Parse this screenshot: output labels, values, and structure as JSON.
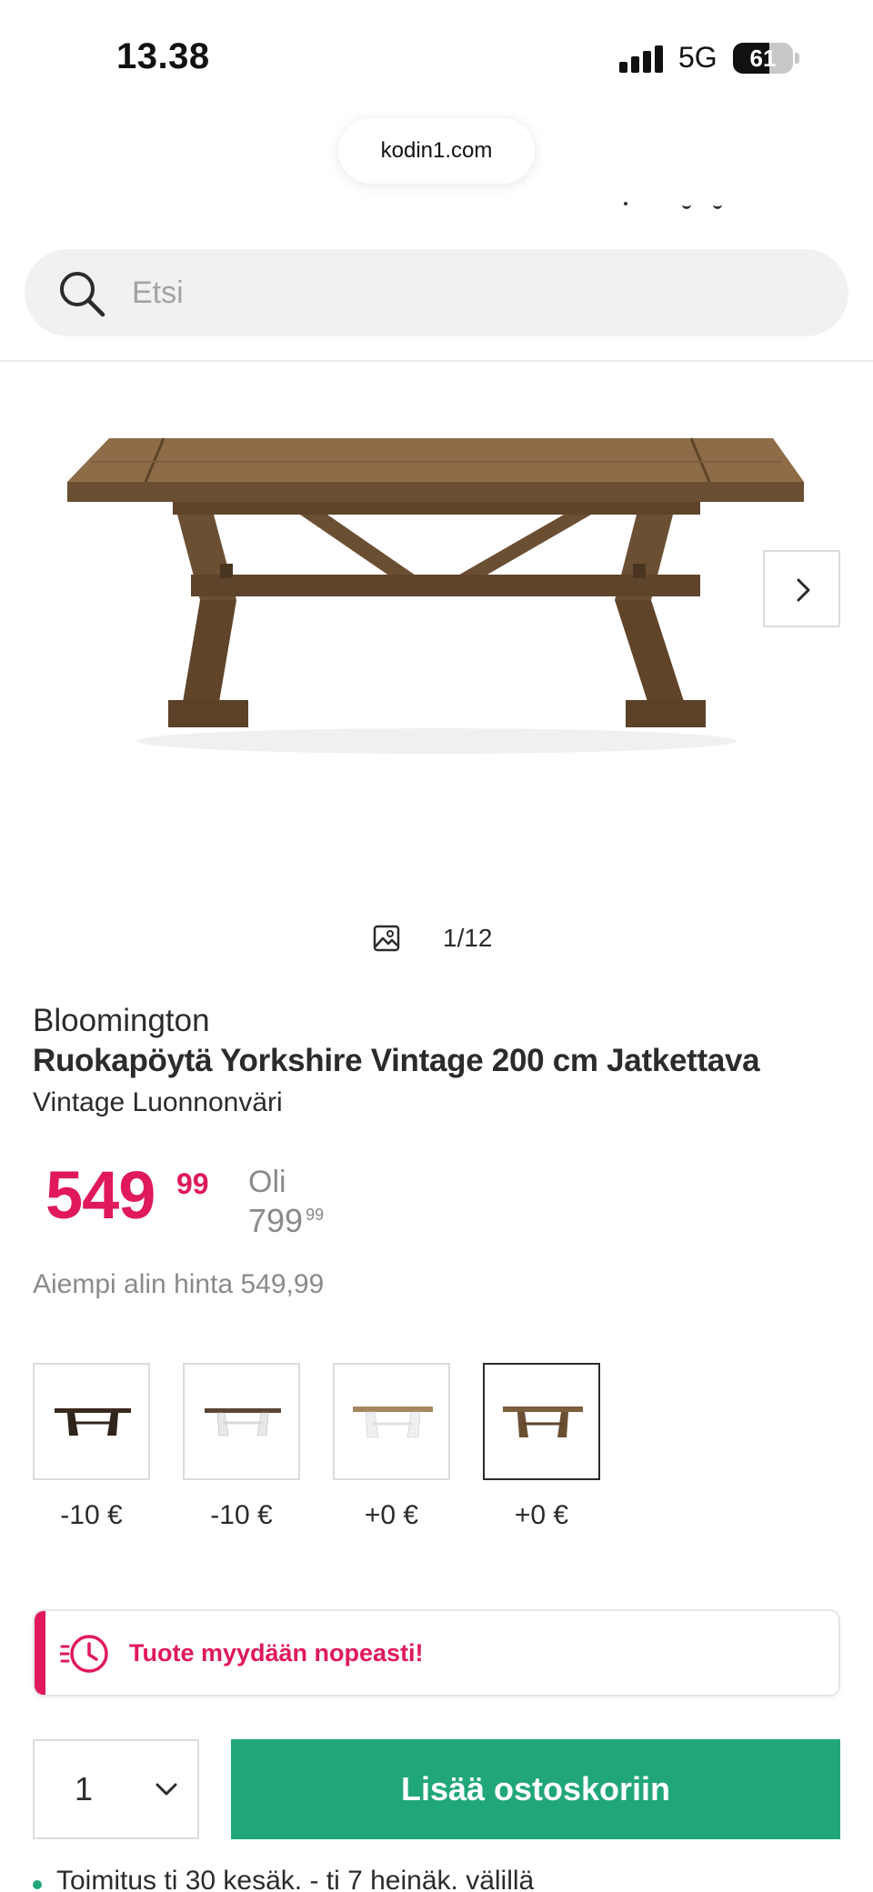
{
  "status_bar": {
    "time": "13.38",
    "network": "5G",
    "battery_percent": "61",
    "battery_level": 0.61
  },
  "browser": {
    "url": "kodin1.com"
  },
  "search": {
    "placeholder": "Etsi",
    "icon": "search-icon"
  },
  "gallery": {
    "counter": "1/12",
    "icon": "image-icon",
    "next_icon": "chevron-right-icon"
  },
  "product": {
    "brand": "Bloomington",
    "title": "Ruokapöytä Yorkshire Vintage 200 cm Jatkettava",
    "variant": "Vintage Luonnonväri"
  },
  "price": {
    "main": "549",
    "cents": "99",
    "old_label": "Oli",
    "old_main": "799",
    "old_cents": "99",
    "lowest": "Aiempi alin hinta 549,99",
    "color": "#e0185e"
  },
  "variants": [
    {
      "price_diff": "-10 €",
      "selected": false
    },
    {
      "price_diff": "-10 €",
      "selected": false
    },
    {
      "price_diff": "+0 €",
      "selected": false
    },
    {
      "price_diff": "+0 €",
      "selected": true
    }
  ],
  "alert": {
    "text": "Tuote myydään nopeasti!",
    "icon": "fast-clock-icon"
  },
  "purchase": {
    "quantity": "1",
    "add_to_cart": "Lisää ostoskoriin",
    "button_color": "#21a67b"
  },
  "delivery": {
    "text": "Toimitus ti 30 kesäk. - ti 7 heinäk. välillä"
  }
}
